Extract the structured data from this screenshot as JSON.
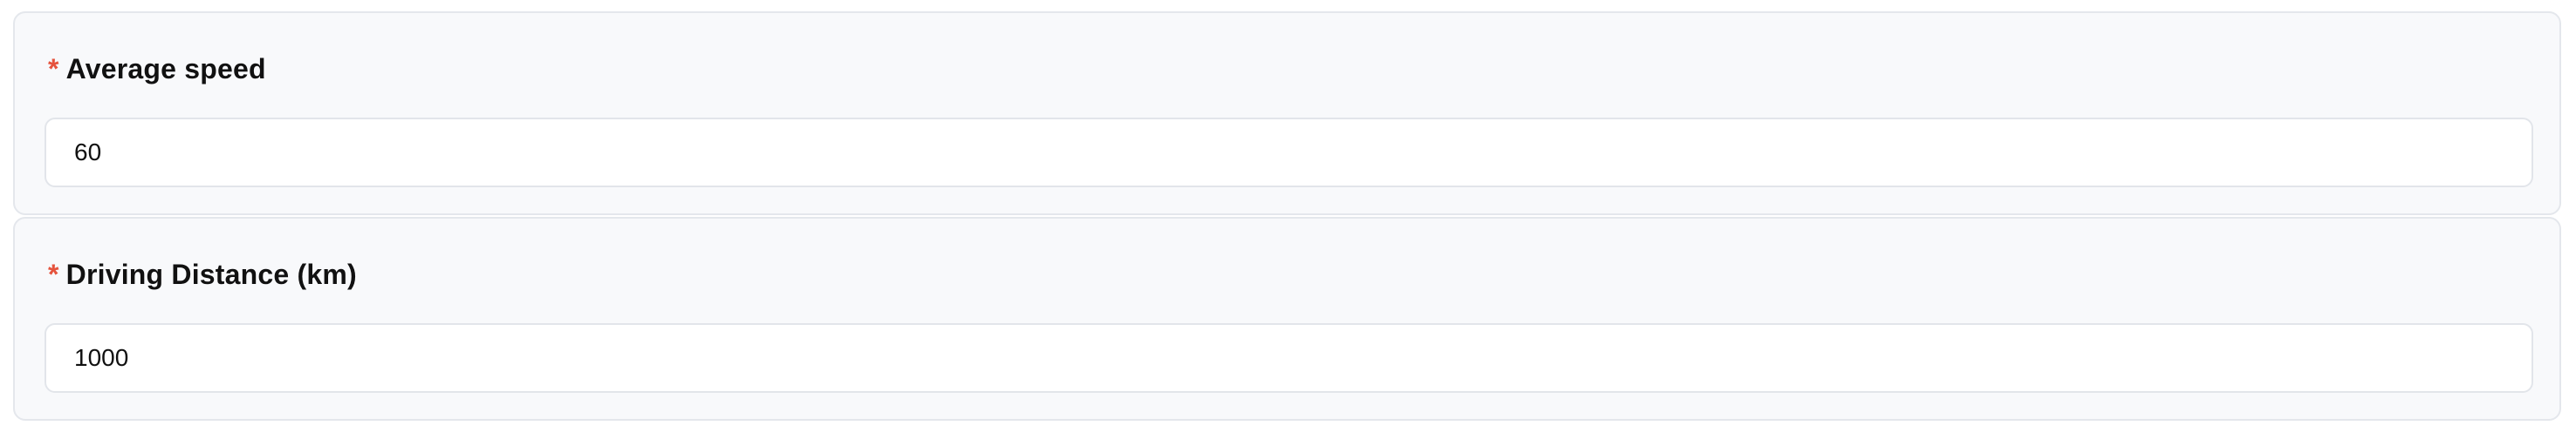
{
  "fields": [
    {
      "required_mark": "*",
      "label": "Average speed",
      "value": "60"
    },
    {
      "required_mark": "*",
      "label": "Driving Distance (km)",
      "value": "1000"
    }
  ],
  "colors": {
    "required_mark": "#e5533d",
    "card_background": "#f8f9fb",
    "card_border": "#e4e7ec",
    "input_border": "#e2e5ea"
  }
}
